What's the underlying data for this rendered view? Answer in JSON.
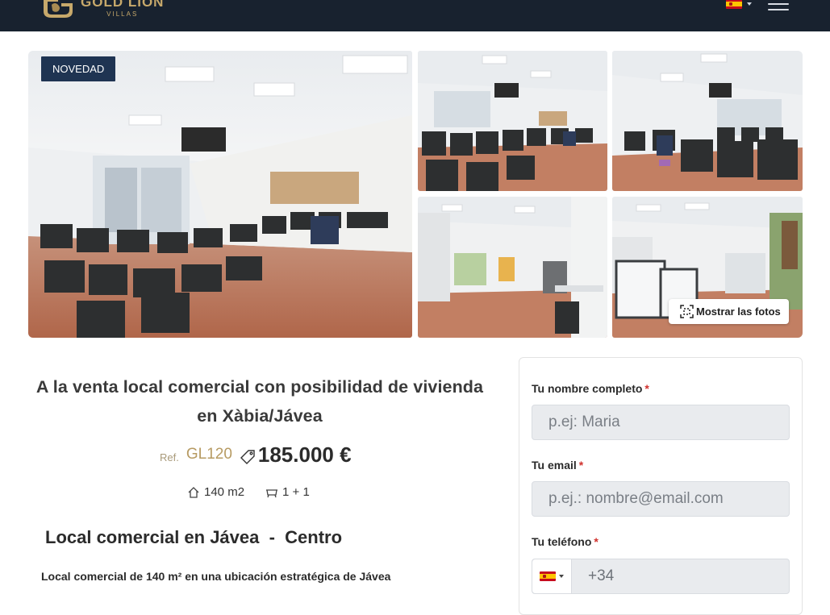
{
  "header": {
    "brand_name": "GOLD LION",
    "brand_sub": "VILLAS",
    "language_flag": "es-flag-icon",
    "menu_icon": "hamburger-icon",
    "colors": {
      "bar": "#18222f",
      "gold": "#c7a96b"
    }
  },
  "gallery": {
    "badge": "NOVEDAD",
    "show_photos_label": "Mostrar las fotos",
    "show_photos_icon": "expand-icon",
    "photos": [
      "main-photo",
      "photo-2",
      "photo-3",
      "photo-4",
      "photo-5"
    ]
  },
  "listing": {
    "title": "A la venta local comercial con posibilidad de vivienda en Xàbia/Jávea",
    "ref_label": "Ref.",
    "ref_value": "GL120",
    "price": "185.000 €",
    "features": [
      {
        "icon": "house-icon",
        "value": "140 m2"
      },
      {
        "icon": "bath-icon",
        "value": "1 + 1"
      }
    ],
    "subtitle": "Local comercial en Jávea  -  Centro",
    "description_first_line": "Local comercial de 140 m² en una ubicación estratégica de Jávea"
  },
  "contact_form": {
    "name_label": "Tu nombre completo",
    "name_placeholder": "p.ej: Maria",
    "email_label": "Tu email",
    "email_placeholder": "p.ej.: nombre@email.com",
    "phone_label": "Tu teléfono",
    "phone_prefix_placeholder": "+34",
    "required_mark": "*",
    "colors": {
      "required": "#d0312d",
      "input_bg": "#e9ebee"
    }
  }
}
